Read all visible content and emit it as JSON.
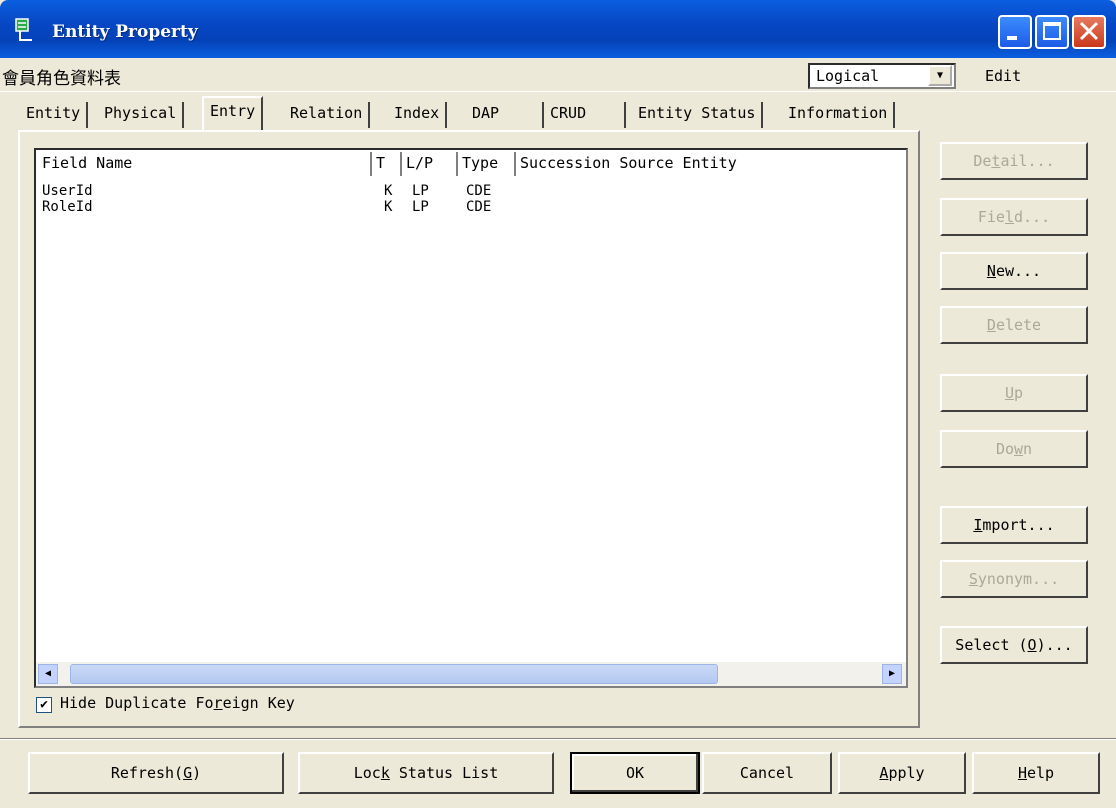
{
  "window": {
    "title": "Entity Property"
  },
  "entity": {
    "name": "會員角色資料表",
    "view_mode": "Logical",
    "edit_label": "Edit"
  },
  "tabs": [
    "Entity",
    "Physical",
    "Entry",
    "Relation",
    "Index",
    "DAP",
    "CRUD",
    "Entity Status",
    "Information"
  ],
  "active_tab": "Entry",
  "table": {
    "columns": [
      "Field  Name",
      "T",
      "L/P",
      "Type",
      "Succession Source Entity"
    ],
    "rows": [
      {
        "name": "UserId",
        "t": "K",
        "lp": "LP",
        "type": "CDE",
        "source": ""
      },
      {
        "name": "RoleId",
        "t": "K",
        "lp": "LP",
        "type": "CDE",
        "source": ""
      }
    ]
  },
  "hide_duplicate_fk": {
    "label_pre": "Hide Duplicate Fo",
    "label_u": "r",
    "label_post": "eign Key",
    "checked": true
  },
  "side_buttons": [
    {
      "pre": "De",
      "u": "t",
      "post": "ail...",
      "enabled": false
    },
    {
      "pre": "Fie",
      "u": "l",
      "post": "d...",
      "enabled": false
    },
    {
      "pre": "",
      "u": "N",
      "post": "ew...",
      "enabled": true
    },
    {
      "pre": "",
      "u": "D",
      "post": "elete",
      "enabled": false
    },
    {
      "pre": "",
      "u": "U",
      "post": "p",
      "enabled": false
    },
    {
      "pre": "Do",
      "u": "w",
      "post": "n",
      "enabled": false
    },
    {
      "pre": "",
      "u": "I",
      "post": "mport...",
      "enabled": true
    },
    {
      "pre": "",
      "u": "S",
      "post": "ynonym...",
      "enabled": false
    },
    {
      "pre": "Select (",
      "u": "O",
      "post": ")...",
      "enabled": true
    }
  ],
  "bottom_buttons": {
    "refresh": {
      "pre": "Refresh(",
      "u": "G",
      "post": ")"
    },
    "lock": {
      "pre": "Loc",
      "u": "k",
      "post": " Status List"
    },
    "ok": "OK",
    "cancel": "Cancel",
    "apply": {
      "pre": "",
      "u": "A",
      "post": "pply"
    },
    "help": {
      "pre": "",
      "u": "H",
      "post": "elp"
    }
  }
}
